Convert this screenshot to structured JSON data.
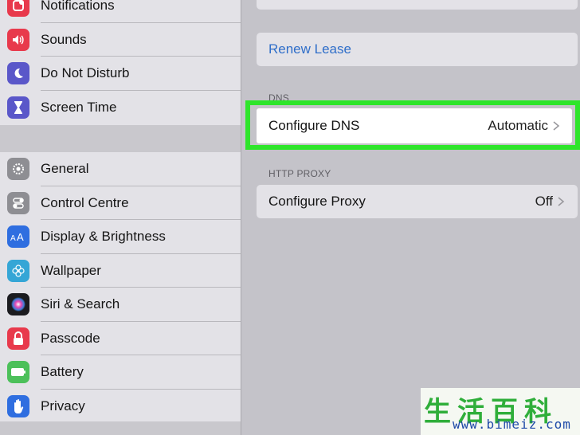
{
  "sidebar": {
    "group1": [
      {
        "label": "Notifications",
        "icon": "notifications-icon",
        "color": "#e8394c"
      },
      {
        "label": "Sounds",
        "icon": "speaker-icon",
        "color": "#e8394c"
      },
      {
        "label": "Do Not Disturb",
        "icon": "moon-icon",
        "color": "#5a57c9"
      },
      {
        "label": "Screen Time",
        "icon": "hourglass-icon",
        "color": "#5a57c9"
      }
    ],
    "group2": [
      {
        "label": "General",
        "icon": "gear-icon",
        "color": "#8e8e93"
      },
      {
        "label": "Control Centre",
        "icon": "toggles-icon",
        "color": "#8e8e93"
      },
      {
        "label": "Display & Brightness",
        "icon": "text-size-icon",
        "color": "#2f6ee0"
      },
      {
        "label": "Wallpaper",
        "icon": "flower-icon",
        "color": "#35a6d6"
      },
      {
        "label": "Siri & Search",
        "icon": "siri-icon",
        "color": "#1b1b1f"
      },
      {
        "label": "Passcode",
        "icon": "lock-icon",
        "color": "#e8394c"
      },
      {
        "label": "Battery",
        "icon": "battery-icon",
        "color": "#4cc05a"
      },
      {
        "label": "Privacy",
        "icon": "hand-icon",
        "color": "#2f6ee0"
      }
    ]
  },
  "main": {
    "renew_lease": "Renew Lease",
    "dns_header": "DNS",
    "configure_dns": {
      "label": "Configure DNS",
      "value": "Automatic"
    },
    "proxy_header": "HTTP PROXY",
    "configure_proxy": {
      "label": "Configure Proxy",
      "value": "Off"
    }
  },
  "colors": {
    "link": "#2f6ec9",
    "highlight": "#2ee52b"
  },
  "watermark": {
    "chars": "生活百科",
    "url": "www.bimeiz.com"
  }
}
